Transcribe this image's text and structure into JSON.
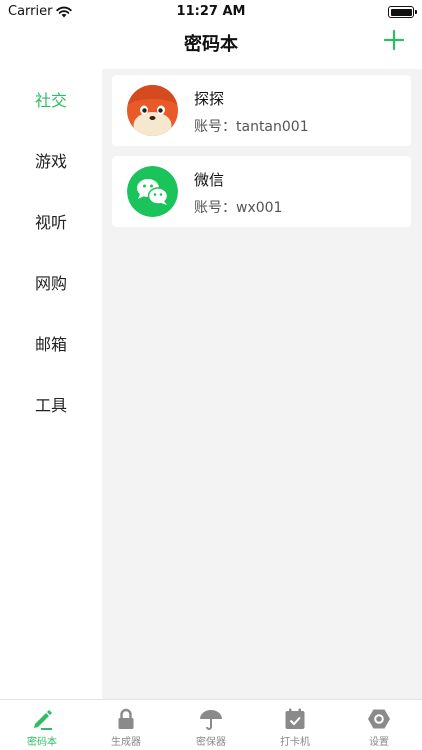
{
  "status_bar": {
    "carrier": "Carrier",
    "time": "11:27 AM"
  },
  "nav": {
    "title": "密码本"
  },
  "sidebar": {
    "items": [
      {
        "label": "社交",
        "active": true
      },
      {
        "label": "游戏"
      },
      {
        "label": "视听"
      },
      {
        "label": "网购"
      },
      {
        "label": "邮箱"
      },
      {
        "label": "工具"
      }
    ]
  },
  "accounts": [
    {
      "name": "探探",
      "account": "账号：tantan001",
      "icon": "tantan-fox-avatar"
    },
    {
      "name": "微信",
      "account": "账号：wx001",
      "icon": "wechat-logo"
    }
  ],
  "tabbar": {
    "items": [
      {
        "label": "密码本",
        "icon": "pen-icon",
        "active": true
      },
      {
        "label": "生成器",
        "icon": "lock-icon"
      },
      {
        "label": "密保器",
        "icon": "umbrella-icon"
      },
      {
        "label": "打卡机",
        "icon": "calendar-check-icon"
      },
      {
        "label": "设置",
        "icon": "hexagon-settings-icon"
      }
    ]
  },
  "colors": {
    "accent": "#2ebd62",
    "content_bg": "#f3f3f3",
    "inactive": "#888888"
  }
}
